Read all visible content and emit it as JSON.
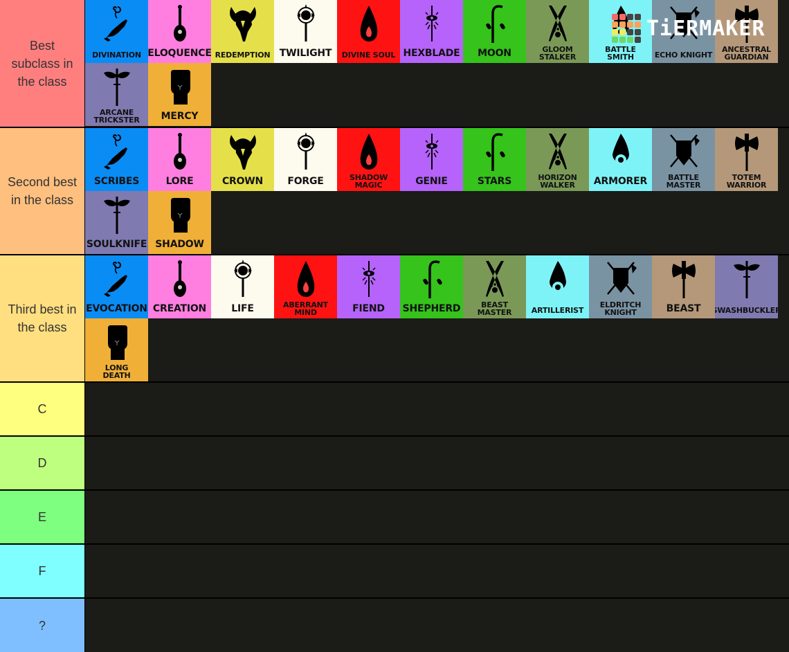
{
  "app": {
    "logo_text": "TiERMAKER"
  },
  "logo_grid": [
    "#f26a6a",
    "#f26a6a",
    "#444444",
    "#444444",
    "#f9a25a",
    "#f9a25a",
    "#f9a25a",
    "#f9a25a",
    "#f0ec5a",
    "#f0ec5a",
    "#444444",
    "#444444",
    "#6bd967",
    "#6bd967",
    "#6bd967",
    "#444444"
  ],
  "tiers": [
    {
      "label": "Best subclass in the class",
      "color": "#ff7f7f",
      "items": [
        {
          "name": "DIVINATION",
          "color": "#0a8cf5",
          "icon": "hand-swirl-icon"
        },
        {
          "name": "ELOQUENCE",
          "color": "#ff7fe0",
          "icon": "lute-icon"
        },
        {
          "name": "REDEMPTION",
          "color": "#e5e04a",
          "icon": "winged-helm-icon"
        },
        {
          "name": "TWILIGHT",
          "color": "#fdfaee",
          "icon": "sun-mace-icon"
        },
        {
          "name": "DIVINE SOUL",
          "color": "#ff1212",
          "icon": "flame-drop-icon"
        },
        {
          "name": "HEXBLADE",
          "color": "#b563fa",
          "icon": "eye-blade-icon"
        },
        {
          "name": "MOON",
          "color": "#35c31c",
          "icon": "sickle-leaves-icon"
        },
        {
          "name": "GLOOM\nSTALKER",
          "color": "#7a9957",
          "icon": "crossed-blades-paw-icon"
        },
        {
          "name": "BATTLE\nSMITH",
          "color": "#7ef3f7",
          "icon": "flaming-gear-icon"
        },
        {
          "name": "ECHO KNIGHT",
          "color": "#7a93a3",
          "icon": "shield-sword-axe-icon"
        },
        {
          "name": "ANCESTRAL\nGUARDIAN",
          "color": "#b59879",
          "icon": "double-axe-icon"
        },
        {
          "name": "ARCANE\nTRICKSTER",
          "color": "#7f7ab0",
          "icon": "mask-dagger-icon"
        },
        {
          "name": "MERCY",
          "color": "#f0af37",
          "icon": "fist-icon"
        }
      ]
    },
    {
      "label": "Second best in the class",
      "color": "#ffbf7f",
      "items": [
        {
          "name": "SCRIBES",
          "color": "#0a8cf5",
          "icon": "hand-swirl-icon"
        },
        {
          "name": "LORE",
          "color": "#ff7fe0",
          "icon": "lute-icon"
        },
        {
          "name": "CROWN",
          "color": "#e5e04a",
          "icon": "winged-helm-icon"
        },
        {
          "name": "FORGE",
          "color": "#fdfaee",
          "icon": "sun-mace-icon"
        },
        {
          "name": "SHADOW\nMAGIC",
          "color": "#ff1212",
          "icon": "flame-drop-icon"
        },
        {
          "name": "GENIE",
          "color": "#b563fa",
          "icon": "eye-blade-icon"
        },
        {
          "name": "STARS",
          "color": "#35c31c",
          "icon": "sickle-leaves-icon"
        },
        {
          "name": "HORIZON\nWALKER",
          "color": "#7a9957",
          "icon": "crossed-blades-paw-icon"
        },
        {
          "name": "ARMORER",
          "color": "#7ef3f7",
          "icon": "flaming-gear-icon"
        },
        {
          "name": "BATTLE\nMASTER",
          "color": "#7a93a3",
          "icon": "shield-sword-axe-icon"
        },
        {
          "name": "TOTEM\nWARRIOR",
          "color": "#b59879",
          "icon": "double-axe-icon"
        },
        {
          "name": "SOULKNIFE",
          "color": "#7f7ab0",
          "icon": "mask-dagger-icon"
        },
        {
          "name": "SHADOW",
          "color": "#f0af37",
          "icon": "fist-icon"
        }
      ]
    },
    {
      "label": "Third best in the class",
      "color": "#ffdf7f",
      "items": [
        {
          "name": "EVOCATION",
          "color": "#0a8cf5",
          "icon": "hand-swirl-icon"
        },
        {
          "name": "CREATION",
          "color": "#ff7fe0",
          "icon": "lute-icon"
        },
        {
          "name": "LIFE",
          "color": "#fdfaee",
          "icon": "sun-mace-icon"
        },
        {
          "name": "ABERRANT\nMIND",
          "color": "#ff1212",
          "icon": "flame-drop-icon"
        },
        {
          "name": "FIEND",
          "color": "#b563fa",
          "icon": "eye-blade-icon"
        },
        {
          "name": "SHEPHERD",
          "color": "#35c31c",
          "icon": "sickle-leaves-icon"
        },
        {
          "name": "BEAST\nMASTER",
          "color": "#7a9957",
          "icon": "crossed-blades-paw-icon"
        },
        {
          "name": "ARTILLERIST",
          "color": "#7ef3f7",
          "icon": "flaming-gear-icon"
        },
        {
          "name": "ELDRITCH\nKNIGHT",
          "color": "#7a93a3",
          "icon": "shield-sword-axe-icon"
        },
        {
          "name": "BEAST",
          "color": "#b59879",
          "icon": "double-axe-icon"
        },
        {
          "name": "SWASHBUCKLER",
          "color": "#7f7ab0",
          "icon": "mask-dagger-icon"
        },
        {
          "name": "LONG\nDEATH",
          "color": "#f0af37",
          "icon": "fist-icon"
        }
      ]
    },
    {
      "label": "C",
      "color": "#ffff7f",
      "items": []
    },
    {
      "label": "D",
      "color": "#bfff7f",
      "items": []
    },
    {
      "label": "E",
      "color": "#7fff7f",
      "items": []
    },
    {
      "label": "F",
      "color": "#7fffff",
      "items": []
    },
    {
      "label": "?",
      "color": "#7fbfff",
      "items": []
    }
  ]
}
